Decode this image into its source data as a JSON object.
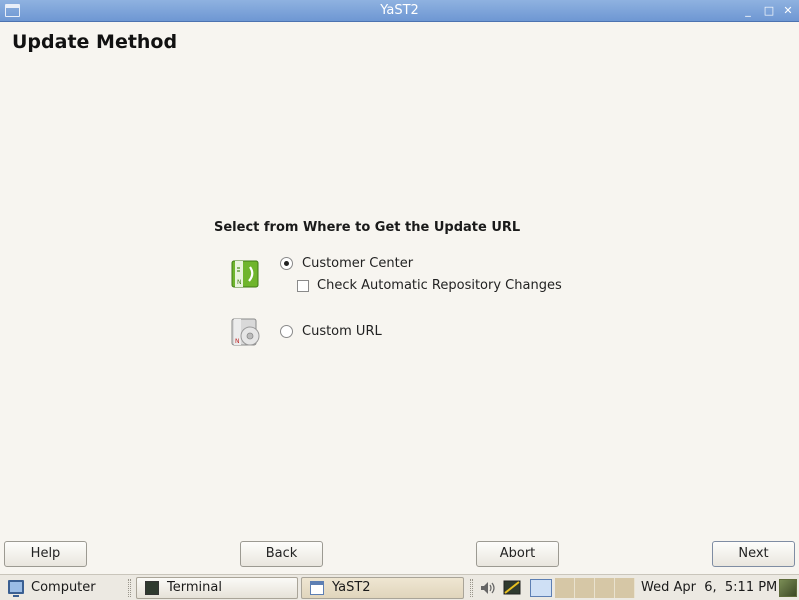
{
  "window": {
    "title": "YaST2",
    "minimize_glyph": "▫",
    "maximize_glyph": "▫",
    "close_glyph": "✕"
  },
  "page": {
    "heading": "Update Method",
    "section_title": "Select from Where to Get the Update URL",
    "options": {
      "customer_center": {
        "label": "Customer Center",
        "mnemonic": "C",
        "selected": true,
        "icon": "customer-center-icon"
      },
      "check_changes": {
        "label": "Check Automatic Repository Changes",
        "mnemonic": "e",
        "checked": false
      },
      "custom_url": {
        "label": "Custom URL",
        "mnemonic": "U",
        "selected": false,
        "icon": "custom-url-cd-icon"
      }
    }
  },
  "buttons": {
    "help": "Help",
    "back": "Back",
    "abort": "Abort",
    "next": "Next"
  },
  "taskbar": {
    "computer_label": "Computer",
    "tasks": [
      {
        "label": "Terminal",
        "icon": "terminal-icon",
        "active": false
      },
      {
        "label": "YaST2",
        "icon": "window-icon",
        "active": true
      }
    ],
    "clock": "Wed Apr  6,  5:11 PM"
  },
  "colors": {
    "titlebar": "#7ea5dc",
    "background": "#f7f5f0",
    "accent_green": "#6bb12a"
  }
}
